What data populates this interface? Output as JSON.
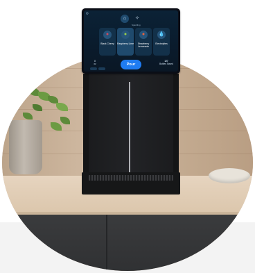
{
  "screen": {
    "top_tabs": [
      {
        "icon": "home-icon",
        "label": ""
      },
      {
        "icon": "sparkle-icon",
        "label": "Sparkling"
      }
    ],
    "flavors": [
      {
        "name": "Black Cherry",
        "subtitle": "",
        "icon": "cherry-icon"
      },
      {
        "name": "Raspberry Lime",
        "subtitle": "",
        "icon": "raspberry-icon"
      },
      {
        "name": "Strawberry Lemonade",
        "subtitle": "",
        "icon": "strawberry-icon"
      },
      {
        "name": "Electrolytes",
        "subtitle": "",
        "icon": "droplet-icon"
      }
    ],
    "pour_label": "Pour",
    "left_info": {
      "a": "8",
      "b": "oz"
    },
    "right_info": {
      "value": "127",
      "label": "Bottles Saved"
    },
    "settings_icon": "gear-icon"
  }
}
